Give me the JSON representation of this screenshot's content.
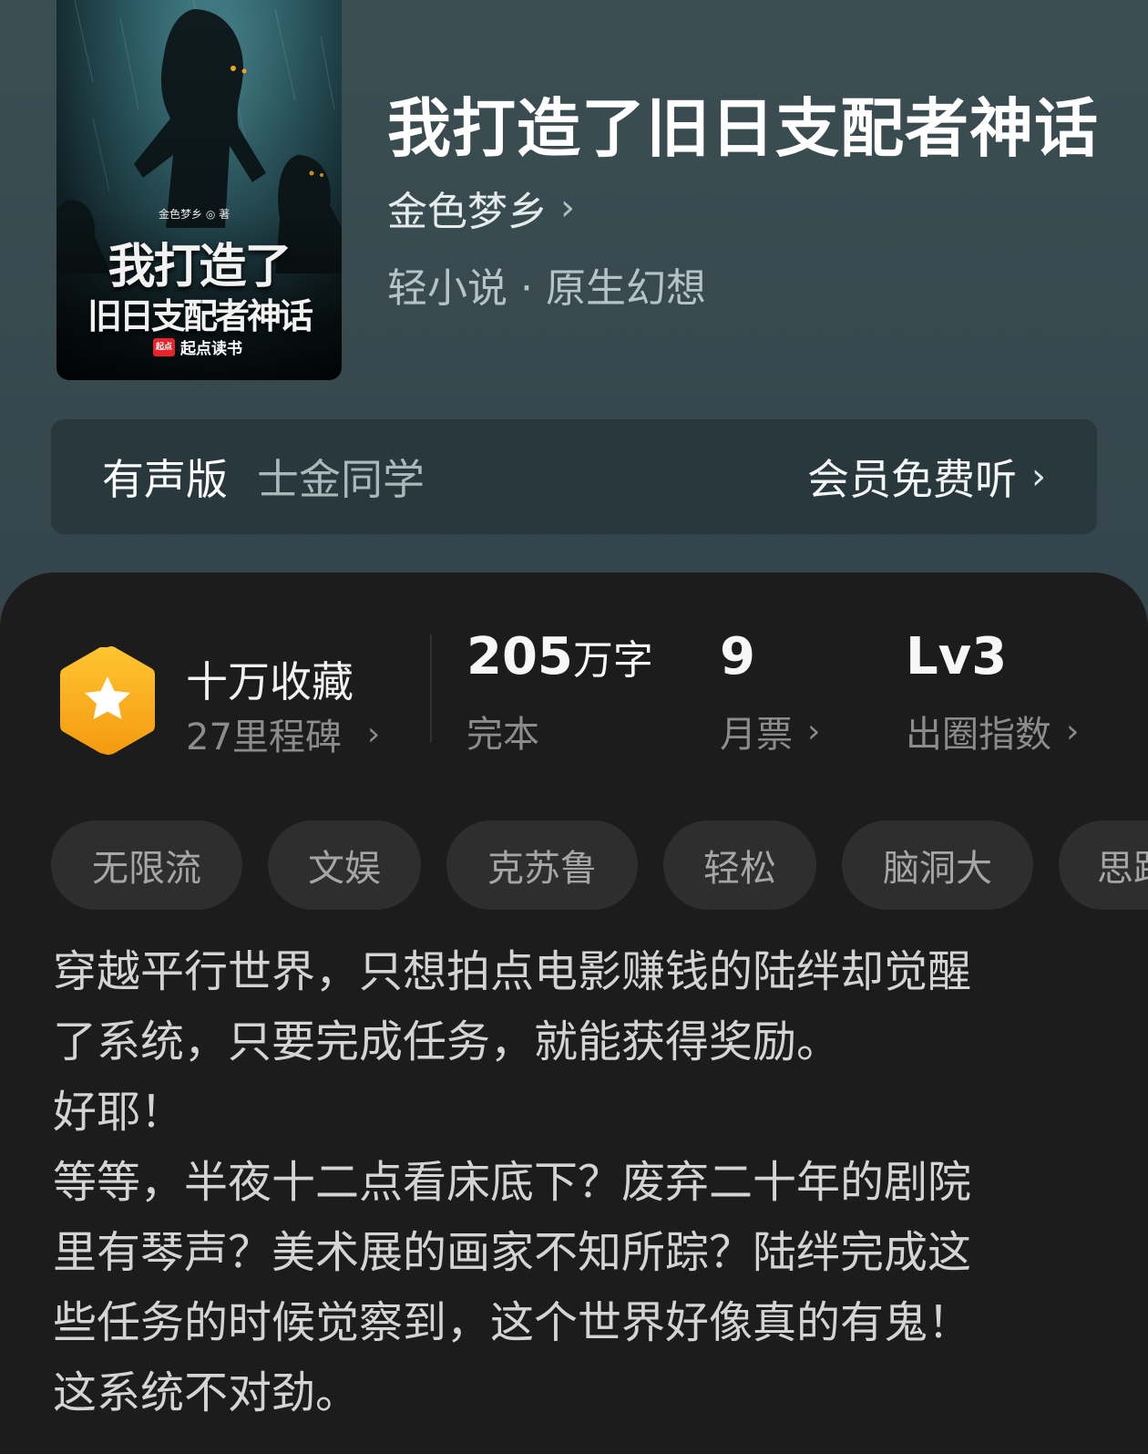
{
  "book": {
    "title": "我打造了旧日支配者神话",
    "author": "金色梦乡",
    "genre": "轻小说 · 原生幻想",
    "cover": {
      "author_line": "金色梦乡 ◎ 著",
      "title_line1": "我打造了",
      "title_line2": "旧日支配者神话",
      "brand_logo": "起点",
      "brand": "起点读书"
    }
  },
  "audio": {
    "label": "有声版",
    "narrator": "士金同学",
    "action": "会员免费听"
  },
  "stats": {
    "collection": {
      "main": "十万收藏",
      "sub": "27里程碑"
    },
    "words": {
      "value": "205",
      "unit": "万字",
      "label": "完本"
    },
    "tickets": {
      "value": "9",
      "label": "月票"
    },
    "index": {
      "value": "Lv3",
      "label": "出圈指数"
    }
  },
  "tags": [
    "无限流",
    "文娱",
    "克苏鲁",
    "轻松",
    "脑洞大",
    "思路"
  ],
  "synopsis": [
    "穿越平行世界，只想拍点电影赚钱的陆绊却觉醒",
    "了系统，只要完成任务，就能获得奖励。",
    "好耶！",
    "等等，半夜十二点看床底下？废弃二十年的剧院",
    "里有琴声？美术展的画家不知所踪？陆绊完成这",
    "些任务的时候觉察到，这个世界好像真的有鬼！",
    "这系统不对劲。"
  ],
  "icons": {
    "chevron": "chevron-right-icon",
    "badge": "star-hexagon-badge-icon"
  },
  "colors": {
    "header_bg": "#3b4e52",
    "panel_bg": "#1c1c1c",
    "badge": "#f7b01e",
    "tag_bg": "#2e2e2e"
  }
}
